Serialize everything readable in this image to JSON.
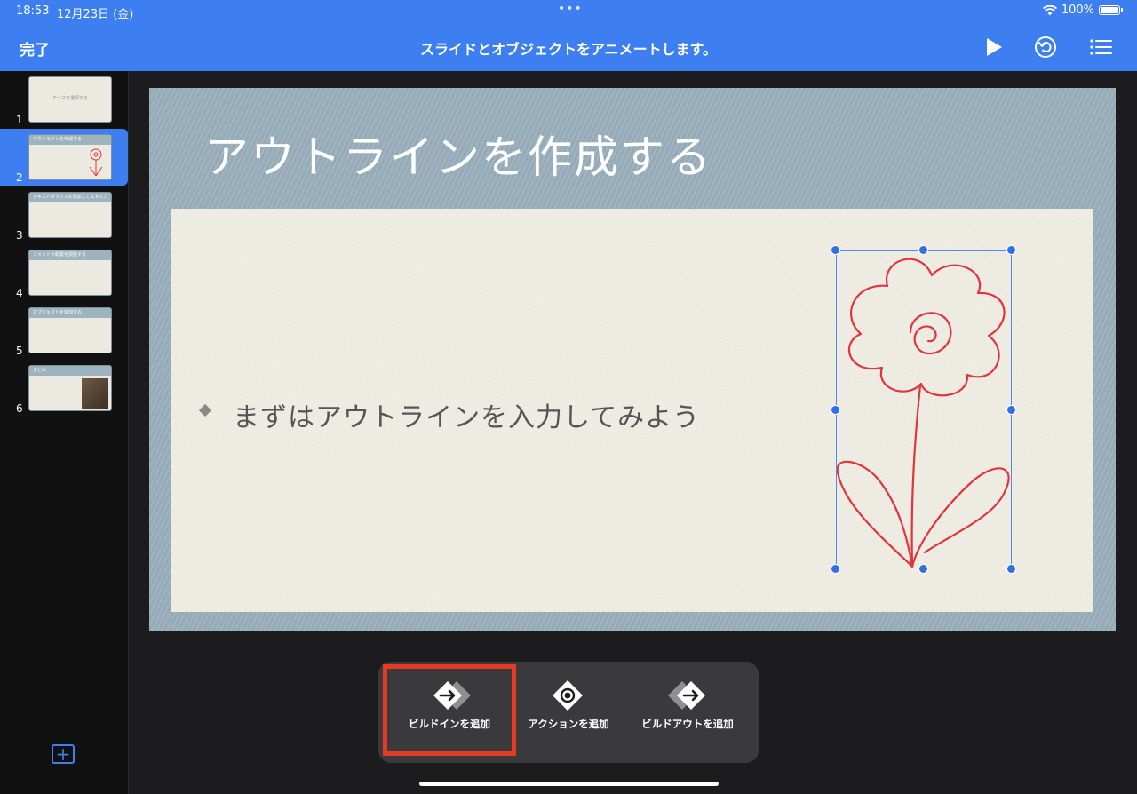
{
  "status_bar": {
    "time": "18:53",
    "date": "12月23日 (金)",
    "dots": "•••",
    "battery": "100%"
  },
  "toolbar": {
    "done_label": "完了",
    "title": "スライドとオブジェクトをアニメートします。"
  },
  "icons": {
    "play": "play-icon",
    "undo": "undo-icon",
    "list": "list-icon",
    "wifi": "wifi-icon",
    "add": "plus-icon"
  },
  "sidebar": {
    "thumbnails": [
      {
        "number": "1",
        "title": "テーマを選択する"
      },
      {
        "number": "2",
        "title": "アウトラインを作成する"
      },
      {
        "number": "3",
        "title": "テキストボックスを追加して文字入力"
      },
      {
        "number": "4",
        "title": "フォントや配置を調整する"
      },
      {
        "number": "5",
        "title": "オブジェクトを追加する"
      },
      {
        "number": "6",
        "title": "まとめ"
      }
    ],
    "selected_index": 2,
    "add_label": "+"
  },
  "slide": {
    "title": "アウトラインを作成する",
    "bullet": "まずはアウトラインを入力してみよう"
  },
  "animation_menu": {
    "build_in_label": "ビルドインを追加",
    "action_label": "アクションを追加",
    "build_out_label": "ビルドアウトを追加"
  },
  "colors": {
    "accent": "#3d7ff0",
    "highlight": "#e53a23",
    "flower": "#e2343a"
  }
}
